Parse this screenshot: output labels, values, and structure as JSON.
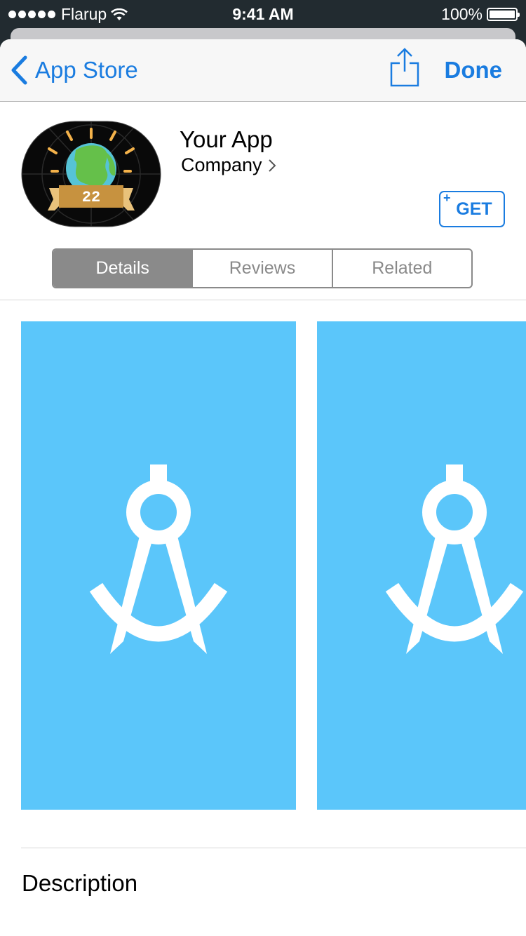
{
  "status_bar": {
    "carrier": "Flarup",
    "time": "9:41 AM",
    "battery": "100%",
    "signal_icon": "signal-dots-icon",
    "wifi_icon": "wifi-icon",
    "battery_icon": "battery-icon"
  },
  "nav": {
    "back_label": "App Store",
    "done_label": "Done",
    "accent_color": "#1a7ce0"
  },
  "app": {
    "name": "Your App",
    "company": "Company",
    "get_label": "GET",
    "get_plus": "+",
    "icon_badge": "22"
  },
  "tabs": [
    {
      "label": "Details",
      "active": true
    },
    {
      "label": "Reviews",
      "active": false
    },
    {
      "label": "Related",
      "active": false
    }
  ],
  "screenshots": {
    "background_color": "#5bc6fa",
    "icon": "compass-icon"
  },
  "description": {
    "title": "Description"
  }
}
